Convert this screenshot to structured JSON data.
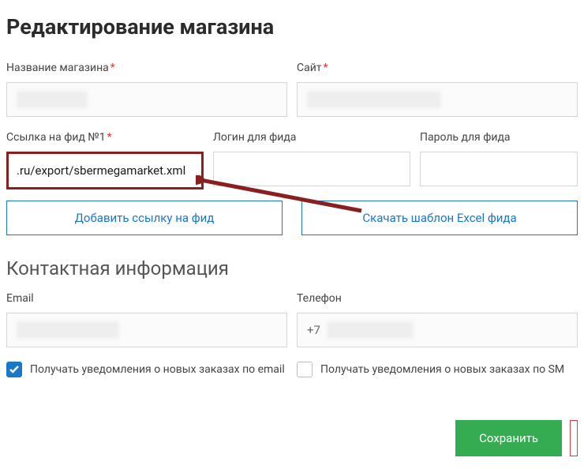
{
  "page": {
    "title": "Редактирование магазина",
    "contact_heading": "Контактная информация"
  },
  "labels": {
    "store_name": "Название магазина",
    "site": "Сайт",
    "feed_url": "Ссылка на фид №1",
    "feed_login": "Логин для фида",
    "feed_password": "Пароль для фида",
    "email": "Email",
    "phone": "Телефон",
    "notify_email": "Получать уведомления о новых заказах по email",
    "notify_sms": "Получать уведомления о новых заказах по SM"
  },
  "values": {
    "feed_url": ".ru/export/sbermegamarket.xml",
    "phone_prefix": "+7",
    "notify_email_checked": true,
    "notify_sms_checked": false
  },
  "buttons": {
    "add_feed": "Добавить ссылку на фид",
    "download_template": "Скачать шаблон Excel фида",
    "save": "Сохранить"
  }
}
